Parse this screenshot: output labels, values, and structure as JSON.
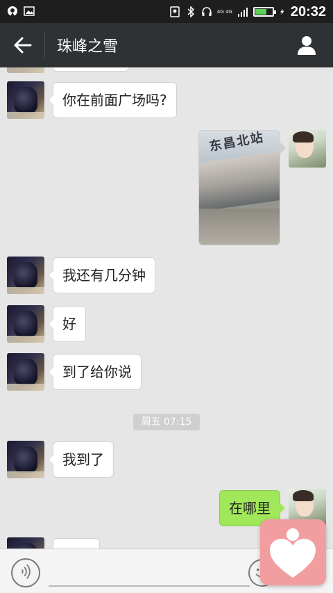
{
  "status_bar": {
    "network": "4G 4G",
    "time": "20:32"
  },
  "header": {
    "title": "珠峰之雪"
  },
  "messages": [
    {
      "side": "left",
      "text": "你在前面广场吗?"
    },
    {
      "side": "right",
      "type": "image",
      "sign_text": "东昌北站"
    },
    {
      "side": "left",
      "text": "我还有几分钟"
    },
    {
      "side": "left",
      "text": "好"
    },
    {
      "side": "left",
      "text": "到了给你说"
    },
    {
      "side": "left",
      "text": "我到了"
    },
    {
      "side": "right",
      "text": "在哪里"
    }
  ],
  "timestamp": "周五 07:15",
  "colors": {
    "status_bar_bg": "#1e1e1e",
    "title_bar_bg": "#2e3234",
    "chat_bg": "#e6e6e6",
    "my_bubble": "#a0e75a",
    "floating_button": "#f29ea0"
  },
  "icons": {
    "back": "back-arrow-icon",
    "profile": "person-icon",
    "voice": "voice-icon",
    "emoji": "emoji-icon",
    "floating": "heart-icon"
  }
}
